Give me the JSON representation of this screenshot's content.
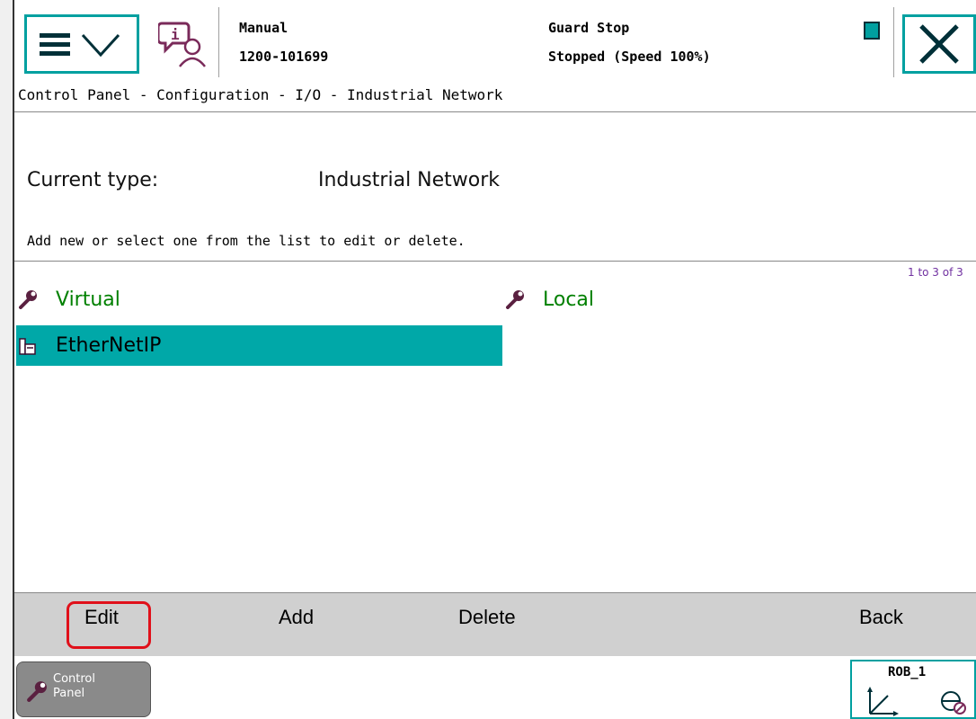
{
  "header": {
    "mode": "Manual",
    "system_id": "1200-101699",
    "state": "Guard Stop",
    "status": "Stopped (Speed 100%)"
  },
  "breadcrumb": "Control Panel - Configuration - I/O - Industrial Network",
  "current_type": {
    "label": "Current type:",
    "value": "Industrial Network"
  },
  "instruction": "Add new or select one from the list to edit or delete.",
  "list": {
    "count": "1 to 3 of 3",
    "items": [
      {
        "label": "Virtual",
        "icon": "wrench-icon"
      },
      {
        "label": "Local",
        "icon": "wrench-icon"
      },
      {
        "label": "EtherNetIP",
        "icon": "network-device-icon",
        "selected": true
      }
    ]
  },
  "commands": {
    "edit": "Edit",
    "add": "Add",
    "delete": "Delete",
    "back": "Back"
  },
  "taskbar": {
    "control_panel": "Control Panel",
    "robot": "ROB_1"
  },
  "colors": {
    "accent": "#00a0a0",
    "selected_row": "#00a8a8",
    "item_text": "#008000",
    "highlight": "#e0101a"
  }
}
